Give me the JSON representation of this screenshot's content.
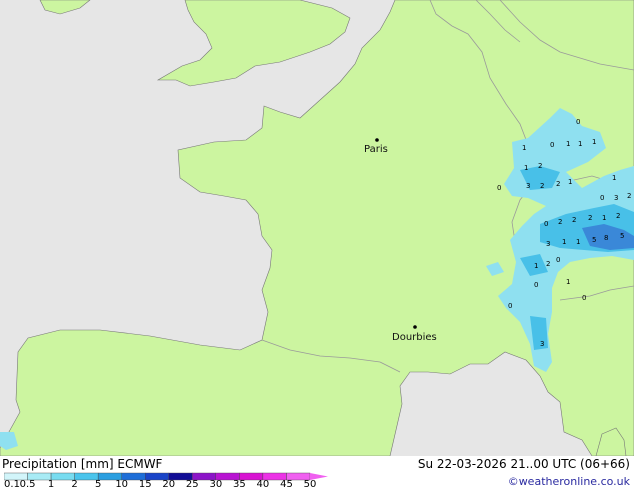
{
  "map": {
    "colors": {
      "sea": "#e6e6e6",
      "land": "#ccf5a0",
      "border": "#9a9a9a",
      "coast": "#777777",
      "precip_light": "#8fe0f0",
      "precip_mid": "#48c0e8",
      "precip_heavy": "#3a88d8"
    },
    "cities": [
      {
        "name": "Paris"
      },
      {
        "name": "Dourbies"
      }
    ],
    "precip_values": [
      "0",
      "1",
      "1",
      "1",
      "0",
      "1",
      "2",
      "1",
      "3",
      "2",
      "2",
      "1",
      "0",
      "1",
      "0",
      "3",
      "2",
      "0",
      "2",
      "2",
      "2",
      "1",
      "2",
      "3",
      "1",
      "1",
      "5",
      "8",
      "5",
      "0",
      "1",
      "2",
      "0",
      "1",
      "0",
      "0",
      "3"
    ]
  },
  "footer": {
    "title_left": "Precipitation [mm] ECMWF",
    "title_right": "Su 22-03-2026 21..00 UTC (06+66)",
    "credit": "©weatheronline.co.uk",
    "legend": {
      "ticks": [
        "0.1",
        "0.5",
        "1",
        "2",
        "5",
        "10",
        "15",
        "20",
        "25",
        "30",
        "35",
        "40",
        "45",
        "50"
      ],
      "colors": [
        "#ffffff",
        "#d2f5fa",
        "#a8ebf5",
        "#78dcf0",
        "#4ac4ec",
        "#2a9ee0",
        "#1e6ed8",
        "#1a44c8",
        "#120e96",
        "#8c14c8",
        "#b814d2",
        "#d814d2",
        "#ec32e6",
        "#f060f0"
      ]
    }
  }
}
